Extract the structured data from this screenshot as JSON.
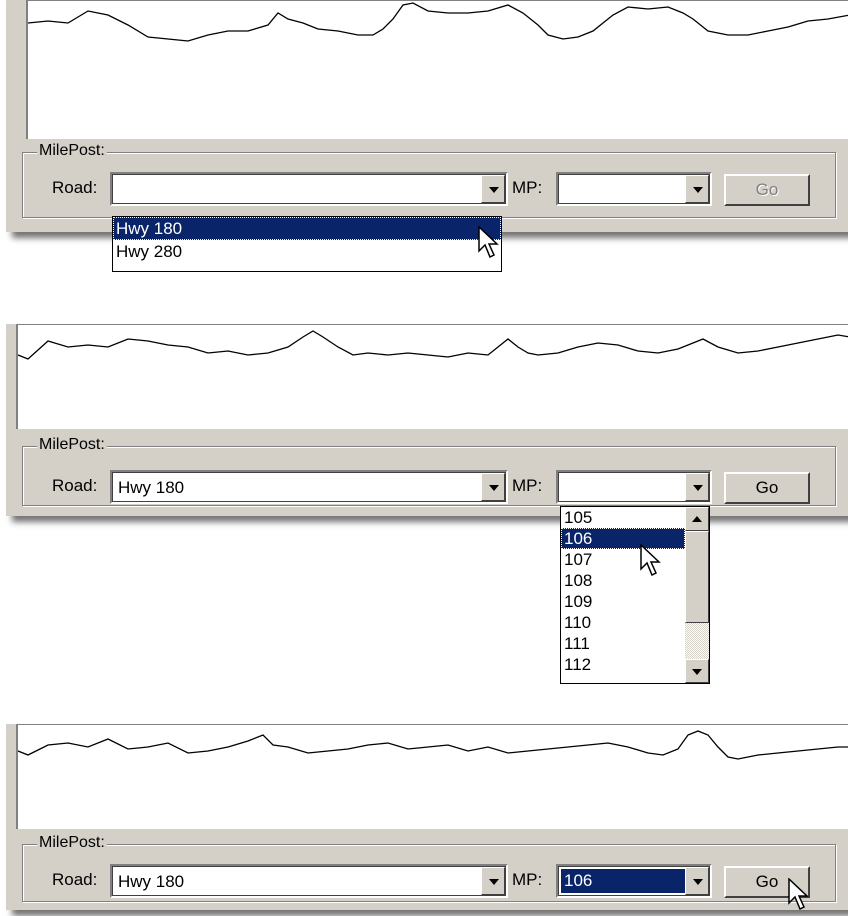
{
  "panels": [
    {
      "groupbox_label": "MilePost:",
      "road_label": "Road:",
      "road_value": "",
      "mp_label": "MP:",
      "mp_value": "",
      "go_label": "Go",
      "go_enabled": false,
      "road_dropdown": {
        "open": true,
        "options": [
          "Hwy 180",
          "Hwy 280"
        ],
        "highlighted": "Hwy 180"
      }
    },
    {
      "groupbox_label": "MilePost:",
      "road_label": "Road:",
      "road_value": "Hwy 180",
      "mp_label": "MP:",
      "mp_value": "",
      "go_label": "Go",
      "go_enabled": true,
      "mp_dropdown": {
        "open": true,
        "options": [
          "105",
          "106",
          "107",
          "108",
          "109",
          "110",
          "111",
          "112"
        ],
        "highlighted": "106"
      }
    },
    {
      "groupbox_label": "MilePost:",
      "road_label": "Road:",
      "road_value": "Hwy 180",
      "mp_label": "MP:",
      "mp_value": "106",
      "mp_selected": true,
      "go_label": "Go",
      "go_enabled": true
    }
  ],
  "colors": {
    "face": "#d4d0c8",
    "highlight": "#0a246a",
    "shadow": "#808080"
  },
  "icons": [
    "arrow-cursor-icon",
    "dropdown-arrow-icon",
    "scroll-up-icon",
    "scroll-down-icon"
  ]
}
